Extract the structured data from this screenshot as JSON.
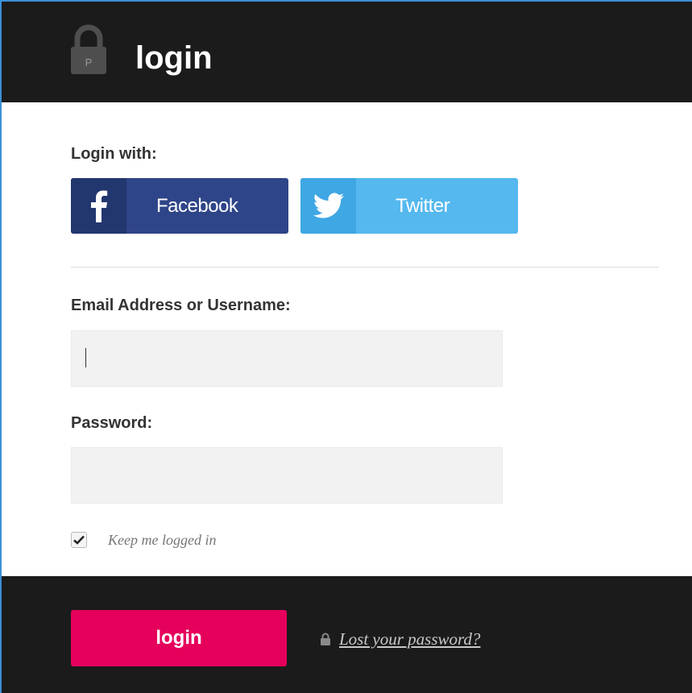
{
  "header": {
    "title": "login",
    "lock_icon_letter": "P"
  },
  "social": {
    "heading": "Login with:",
    "facebook_label": "Facebook",
    "twitter_label": "Twitter",
    "facebook_color": "#2f4589",
    "twitter_color": "#55b8ef"
  },
  "form": {
    "email_label": "Email Address or Username:",
    "email_value": "",
    "password_label": "Password:",
    "password_value": "",
    "keep_logged_in_label": "Keep me logged in",
    "keep_logged_in_checked": true
  },
  "footer": {
    "login_label": "login",
    "lost_password_label": "Lost your password?",
    "accent_color": "#e5005c"
  }
}
